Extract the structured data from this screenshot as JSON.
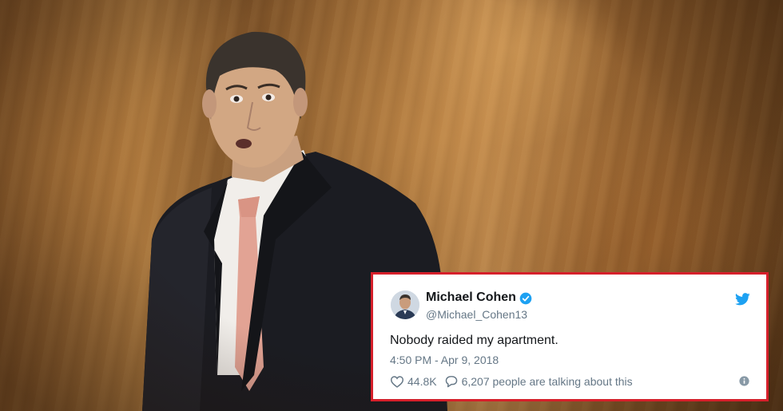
{
  "colors": {
    "card_border": "#d6202b",
    "twitter_blue": "#1da1f2",
    "text_primary": "#14171a",
    "text_secondary": "#657786"
  },
  "tweet": {
    "author_name": "Michael Cohen",
    "handle": "@Michael_Cohen13",
    "verified": true,
    "text": "Nobody raided my apartment.",
    "timestamp": "4:50 PM - Apr 9, 2018",
    "likes": "44.8K",
    "talking": "6,207 people are talking about this",
    "icons": [
      "verified-badge-icon",
      "twitter-bird-icon",
      "heart-icon",
      "reply-icon",
      "info-icon"
    ]
  }
}
